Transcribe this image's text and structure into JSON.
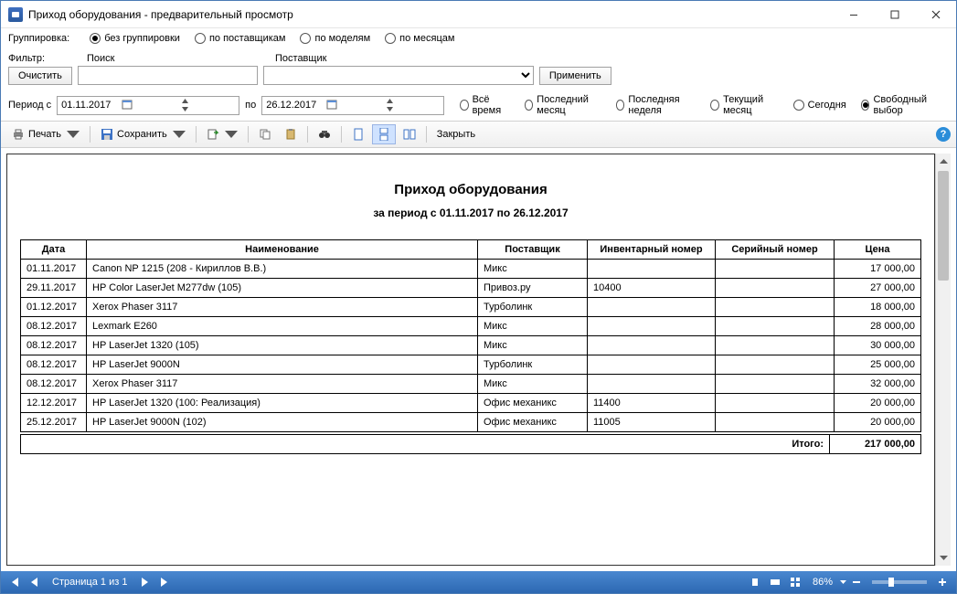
{
  "window": {
    "title": "Приход оборудования - предварительный просмотр"
  },
  "grouping": {
    "label": "Группировка:",
    "options": {
      "none": "без группировки",
      "by_supplier": "по поставщикам",
      "by_model": "по моделям",
      "by_month": "по месяцам"
    }
  },
  "filter": {
    "label": "Фильтр:",
    "clear": "Очистить",
    "search_label": "Поиск",
    "supplier_label": "Поставщик",
    "apply": "Применить"
  },
  "period": {
    "label": "Период с",
    "from": "01.11.2017",
    "to_label": "по",
    "to": "26.12.2017",
    "options": {
      "all": "Всё время",
      "last_month": "Последний месяц",
      "last_week": "Последняя неделя",
      "current_month": "Текущий месяц",
      "today": "Сегодня",
      "free": "Свободный выбор"
    }
  },
  "toolbar": {
    "print": "Печать",
    "save": "Сохранить",
    "close": "Закрыть"
  },
  "report": {
    "title": "Приход оборудования",
    "subtitle": "за период с 01.11.2017 по 26.12.2017",
    "headers": {
      "date": "Дата",
      "name": "Наименование",
      "supplier": "Поставщик",
      "inventory": "Инвентарный номер",
      "serial": "Серийный номер",
      "price": "Цена"
    },
    "rows": [
      {
        "date": "01.11.2017",
        "name": "Canon NP 1215 (208 - Кириллов В.В.)",
        "supplier": "Микс",
        "inventory": "",
        "serial": "",
        "price": "17 000,00"
      },
      {
        "date": "29.11.2017",
        "name": "HP Color LaserJet M277dw (105)",
        "supplier": "Привоз.ру",
        "inventory": "10400",
        "serial": "",
        "price": "27 000,00"
      },
      {
        "date": "01.12.2017",
        "name": "Xerox Phaser 3117",
        "supplier": "Турболинк",
        "inventory": "",
        "serial": "",
        "price": "18 000,00"
      },
      {
        "date": "08.12.2017",
        "name": "Lexmark E260",
        "supplier": "Микс",
        "inventory": "",
        "serial": "",
        "price": "28 000,00"
      },
      {
        "date": "08.12.2017",
        "name": "HP LaserJet 1320 (105)",
        "supplier": "Микс",
        "inventory": "",
        "serial": "",
        "price": "30 000,00"
      },
      {
        "date": "08.12.2017",
        "name": "HP LaserJet 9000N",
        "supplier": "Турболинк",
        "inventory": "",
        "serial": "",
        "price": "25 000,00"
      },
      {
        "date": "08.12.2017",
        "name": "Xerox Phaser 3117",
        "supplier": "Микс",
        "inventory": "",
        "serial": "",
        "price": "32 000,00"
      },
      {
        "date": "12.12.2017",
        "name": "HP LaserJet 1320 (100: Реализация)",
        "supplier": "Офис механикс",
        "inventory": "11400",
        "serial": "",
        "price": "20 000,00"
      },
      {
        "date": "25.12.2017",
        "name": "HP LaserJet 9000N (102)",
        "supplier": "Офис механикс",
        "inventory": "11005",
        "serial": "",
        "price": "20 000,00"
      }
    ],
    "total_label": "Итого:",
    "total": "217 000,00"
  },
  "navbar": {
    "page_text": "Страница 1 из 1",
    "zoom": "86%"
  }
}
